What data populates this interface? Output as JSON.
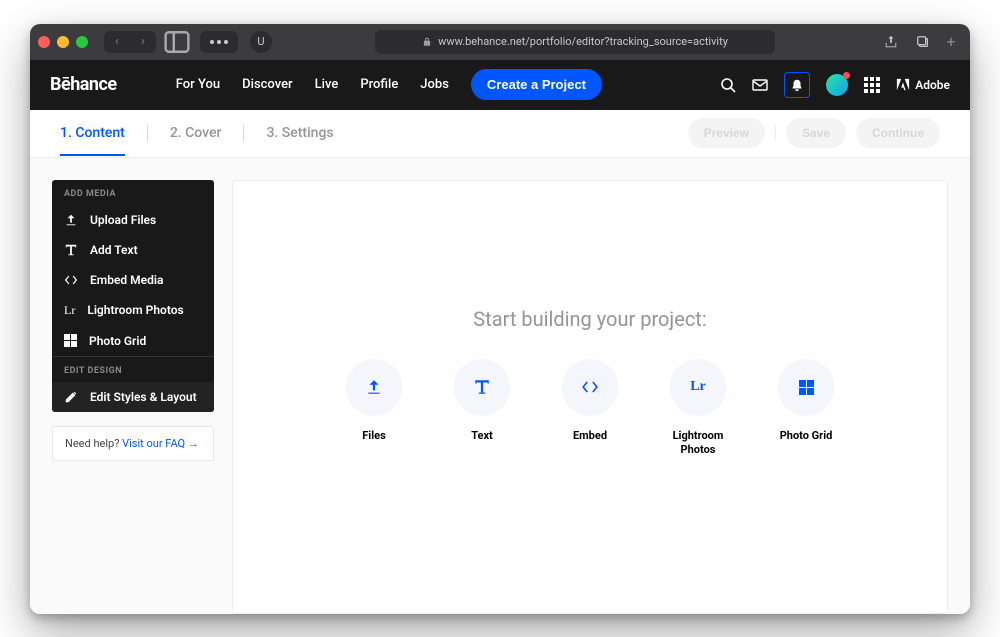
{
  "browser": {
    "url": "www.behance.net/portfolio/editor?tracking_source=activity"
  },
  "header": {
    "logo": "Bēhance",
    "nav": {
      "for_you": "For You",
      "discover": "Discover",
      "live": "Live",
      "profile": "Profile",
      "jobs": "Jobs"
    },
    "cta": "Create a Project",
    "adobe": "Adobe"
  },
  "steps": {
    "s1": "1. Content",
    "s2": "2. Cover",
    "s3": "3. Settings",
    "preview": "Preview",
    "save": "Save",
    "continue": "Continue"
  },
  "sidebar": {
    "add_media_header": "ADD MEDIA",
    "items": [
      {
        "label": "Upload Files"
      },
      {
        "label": "Add Text"
      },
      {
        "label": "Embed Media"
      },
      {
        "label": "Lightroom Photos"
      },
      {
        "label": "Photo Grid"
      }
    ],
    "edit_design_header": "EDIT DESIGN",
    "edit_styles": "Edit Styles & Layout",
    "help_text": "Need help? ",
    "help_link": "Visit our FAQ →"
  },
  "canvas": {
    "heading": "Start building your project:",
    "tiles": {
      "files": "Files",
      "text": "Text",
      "embed": "Embed",
      "lightroom": "Lightroom Photos",
      "grid": "Photo Grid"
    }
  }
}
